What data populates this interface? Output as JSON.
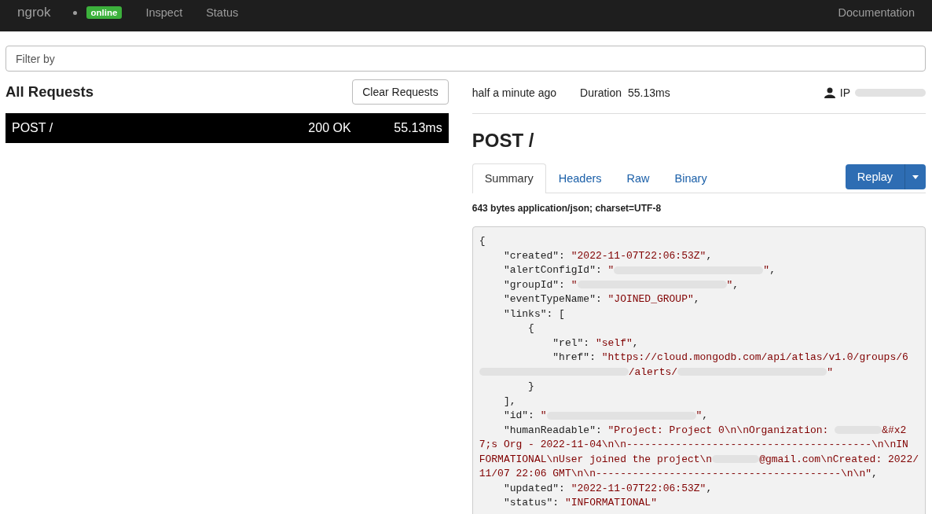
{
  "navbar": {
    "brand": "ngrok",
    "status_badge": "online",
    "links": [
      {
        "label": "Inspect",
        "selected": false
      },
      {
        "label": "Status",
        "selected": false
      }
    ],
    "right_link": "Documentation"
  },
  "filter": {
    "placeholder": "Filter by"
  },
  "requests": {
    "title": "All Requests",
    "clear_button": "Clear Requests",
    "rows": [
      {
        "method_path": "POST /",
        "status": "200 OK",
        "duration": "55.13ms",
        "selected": true
      }
    ]
  },
  "detail": {
    "time": "half a minute ago",
    "duration_label": "Duration",
    "duration": "55.13ms",
    "ip_label": "IP",
    "title": "POST /",
    "tabs": [
      {
        "label": "Summary",
        "selected": true
      },
      {
        "label": "Headers",
        "selected": false
      },
      {
        "label": "Raw",
        "selected": false
      },
      {
        "label": "Binary",
        "selected": false
      }
    ],
    "replay_button": "Replay",
    "body_info": "643 bytes application/json; charset=UTF-8",
    "code_lines": [
      [
        {
          "kind": "code",
          "text": "{"
        }
      ],
      [
        {
          "kind": "code",
          "text": "    \"created\": "
        },
        {
          "kind": "string",
          "text": "\"2022-11-07T22:06:53Z\""
        },
        {
          "kind": "code",
          "text": ","
        }
      ],
      [
        {
          "kind": "code",
          "text": "    \"alertConfigId\": "
        },
        {
          "kind": "string",
          "text": "\""
        },
        {
          "kind": "redacted"
        },
        {
          "kind": "string",
          "text": "\""
        },
        {
          "kind": "code",
          "text": ","
        }
      ],
      [
        {
          "kind": "code",
          "text": "    \"groupId\": "
        },
        {
          "kind": "string",
          "text": "\""
        },
        {
          "kind": "redacted"
        },
        {
          "kind": "string",
          "text": "\""
        },
        {
          "kind": "code",
          "text": ","
        }
      ],
      [
        {
          "kind": "code",
          "text": "    \"eventTypeName\": "
        },
        {
          "kind": "string",
          "text": "\"JOINED_GROUP\""
        },
        {
          "kind": "code",
          "text": ","
        }
      ],
      [
        {
          "kind": "code",
          "text": "    \"links\": ["
        }
      ],
      [
        {
          "kind": "code",
          "text": "        {"
        }
      ],
      [
        {
          "kind": "code",
          "text": "            \"rel\": "
        },
        {
          "kind": "string",
          "text": "\"self\""
        },
        {
          "kind": "code",
          "text": ","
        }
      ],
      [
        {
          "kind": "code",
          "text": "            \"href\": "
        },
        {
          "kind": "string",
          "text": "\"https://cloud.mongodb.com/api/atlas/v1.0/groups/6"
        }
      ],
      [
        {
          "kind": "redacted"
        },
        {
          "kind": "string",
          "text": "/alerts/"
        },
        {
          "kind": "redacted"
        },
        {
          "kind": "string",
          "text": "\""
        }
      ],
      [
        {
          "kind": "code",
          "text": "        }"
        }
      ],
      [
        {
          "kind": "code",
          "text": "    ],"
        }
      ],
      [
        {
          "kind": "code",
          "text": "    \"id\": "
        },
        {
          "kind": "string",
          "text": "\""
        },
        {
          "kind": "redacted"
        },
        {
          "kind": "string",
          "text": "\""
        },
        {
          "kind": "code",
          "text": ","
        }
      ],
      [
        {
          "kind": "code",
          "text": "    \"humanReadable\": "
        },
        {
          "kind": "string",
          "text": "\"Project: Project 0\\n\\nOrganization: "
        },
        {
          "kind": "redacted-short"
        },
        {
          "kind": "string",
          "text": "&#x2"
        }
      ],
      [
        {
          "kind": "string",
          "text": "7;s Org - 2022-11-04\\n\\n----------------------------------------\\n\\nIN"
        }
      ],
      [
        {
          "kind": "string",
          "text": "FORMATIONAL\\nUser joined the project\\n"
        },
        {
          "kind": "redacted-short"
        },
        {
          "kind": "string",
          "text": "@gmail.com\\nCreated: 2022/"
        }
      ],
      [
        {
          "kind": "string",
          "text": "11/07 22:06 GMT\\n\\n----------------------------------------\\n\\n\""
        },
        {
          "kind": "code",
          "text": ","
        }
      ],
      [
        {
          "kind": "code",
          "text": "    \"updated\": "
        },
        {
          "kind": "string",
          "text": "\"2022-11-07T22:06:53Z\""
        },
        {
          "kind": "code",
          "text": ","
        }
      ],
      [
        {
          "kind": "code",
          "text": "    \"status\": "
        },
        {
          "kind": "string",
          "text": "\"INFORMATIONAL\""
        }
      ]
    ]
  }
}
